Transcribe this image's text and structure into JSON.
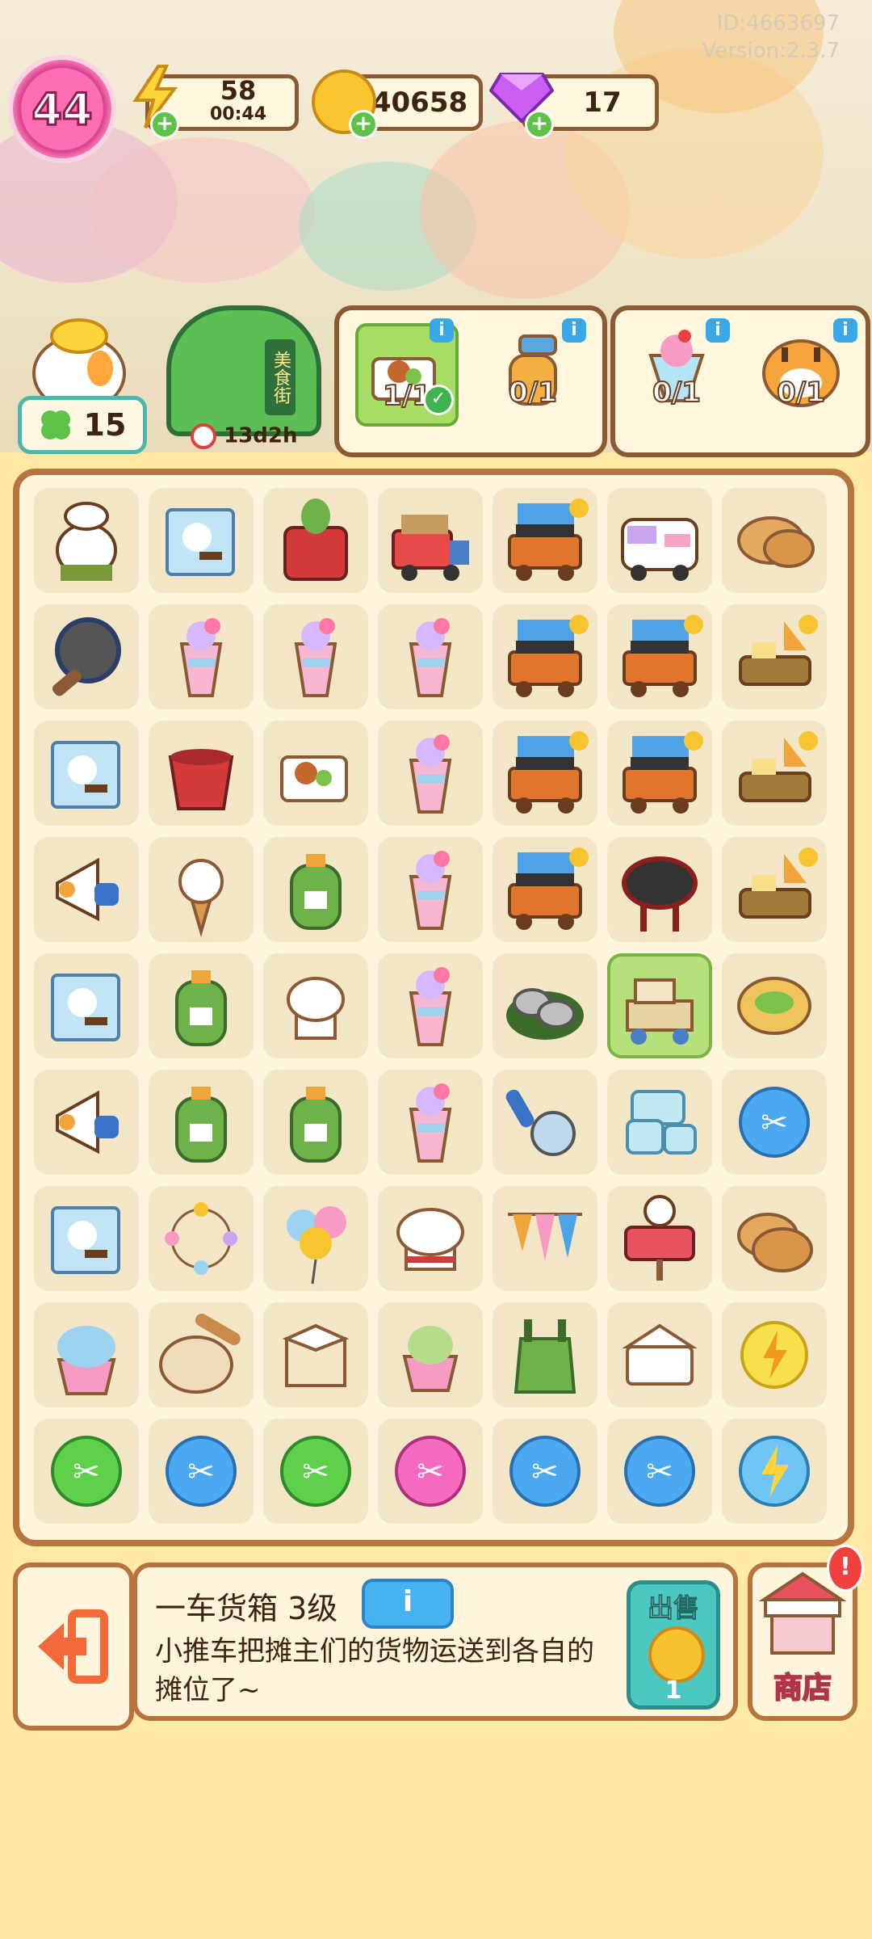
{
  "debug": {
    "id": "ID:4663697",
    "version": "Version:2.3.7"
  },
  "player": {
    "level": "44"
  },
  "resources": {
    "energy": {
      "value": "58",
      "timer": "00:44"
    },
    "coins": {
      "value": "40658"
    },
    "gems": {
      "value": "17"
    }
  },
  "quest_area": {
    "stars": "15",
    "street_name": "美食街",
    "street_timer": "13d2h",
    "order1": [
      {
        "icon": "lunchbox",
        "count": "1/1",
        "done": true
      },
      {
        "icon": "spray-bottle",
        "count": "0/1",
        "done": false
      }
    ],
    "order2": [
      {
        "icon": "parfait",
        "count": "0/1",
        "done": false
      },
      {
        "icon": "tiger",
        "count": "0/1",
        "done": false
      }
    ],
    "info_symbol": "i"
  },
  "board": {
    "rows": [
      [
        "chef-duck",
        "recipe-card",
        "cactus-toaster",
        "delivery-truck",
        "bbq-cart",
        "ice-cream-van",
        "pancakes"
      ],
      [
        "frying-pan",
        "sundae",
        "sundae",
        "sundae",
        "bbq-cart",
        "bbq-cart",
        "scooter-stall"
      ],
      [
        "recipe-card",
        "bucket",
        "lunchbox",
        "sundae",
        "bbq-cart",
        "bbq-cart",
        "scooter-stall"
      ],
      [
        "megaphone",
        "ice-cream-cone",
        "gas-tank",
        "sundae",
        "bbq-cart",
        "grill",
        "scooter-stall"
      ],
      [
        "recipe-card",
        "gas-tank",
        "chef-hat-white",
        "sundae",
        "oysters",
        "cargo-cart",
        "wrap"
      ],
      [
        "megaphone",
        "gas-tank",
        "gas-tank",
        "sundae",
        "scoop",
        "cups",
        "scissors-blue"
      ],
      [
        "recipe-card",
        "bead-garland",
        "balloons",
        "chef-hat",
        "bunting",
        "open-sign",
        "cookies"
      ],
      [
        "shaved-ice",
        "dough",
        "box",
        "matcha-cup",
        "overalls",
        "takeout-box",
        "energy-coin"
      ],
      [
        "scissors-green",
        "scissors-blue",
        "scissors-green",
        "scissors-pink",
        "scissors-blue",
        "scissors-blue",
        "energy-bubble"
      ]
    ]
  },
  "bottom": {
    "item_title": "一车货箱 3级",
    "info_label": "i",
    "description": "小推车把摊主们的货物运送到各自的摊位了~",
    "sell_label": "出售",
    "sell_amount": "1",
    "shop_label": "商店",
    "alert": "!"
  }
}
